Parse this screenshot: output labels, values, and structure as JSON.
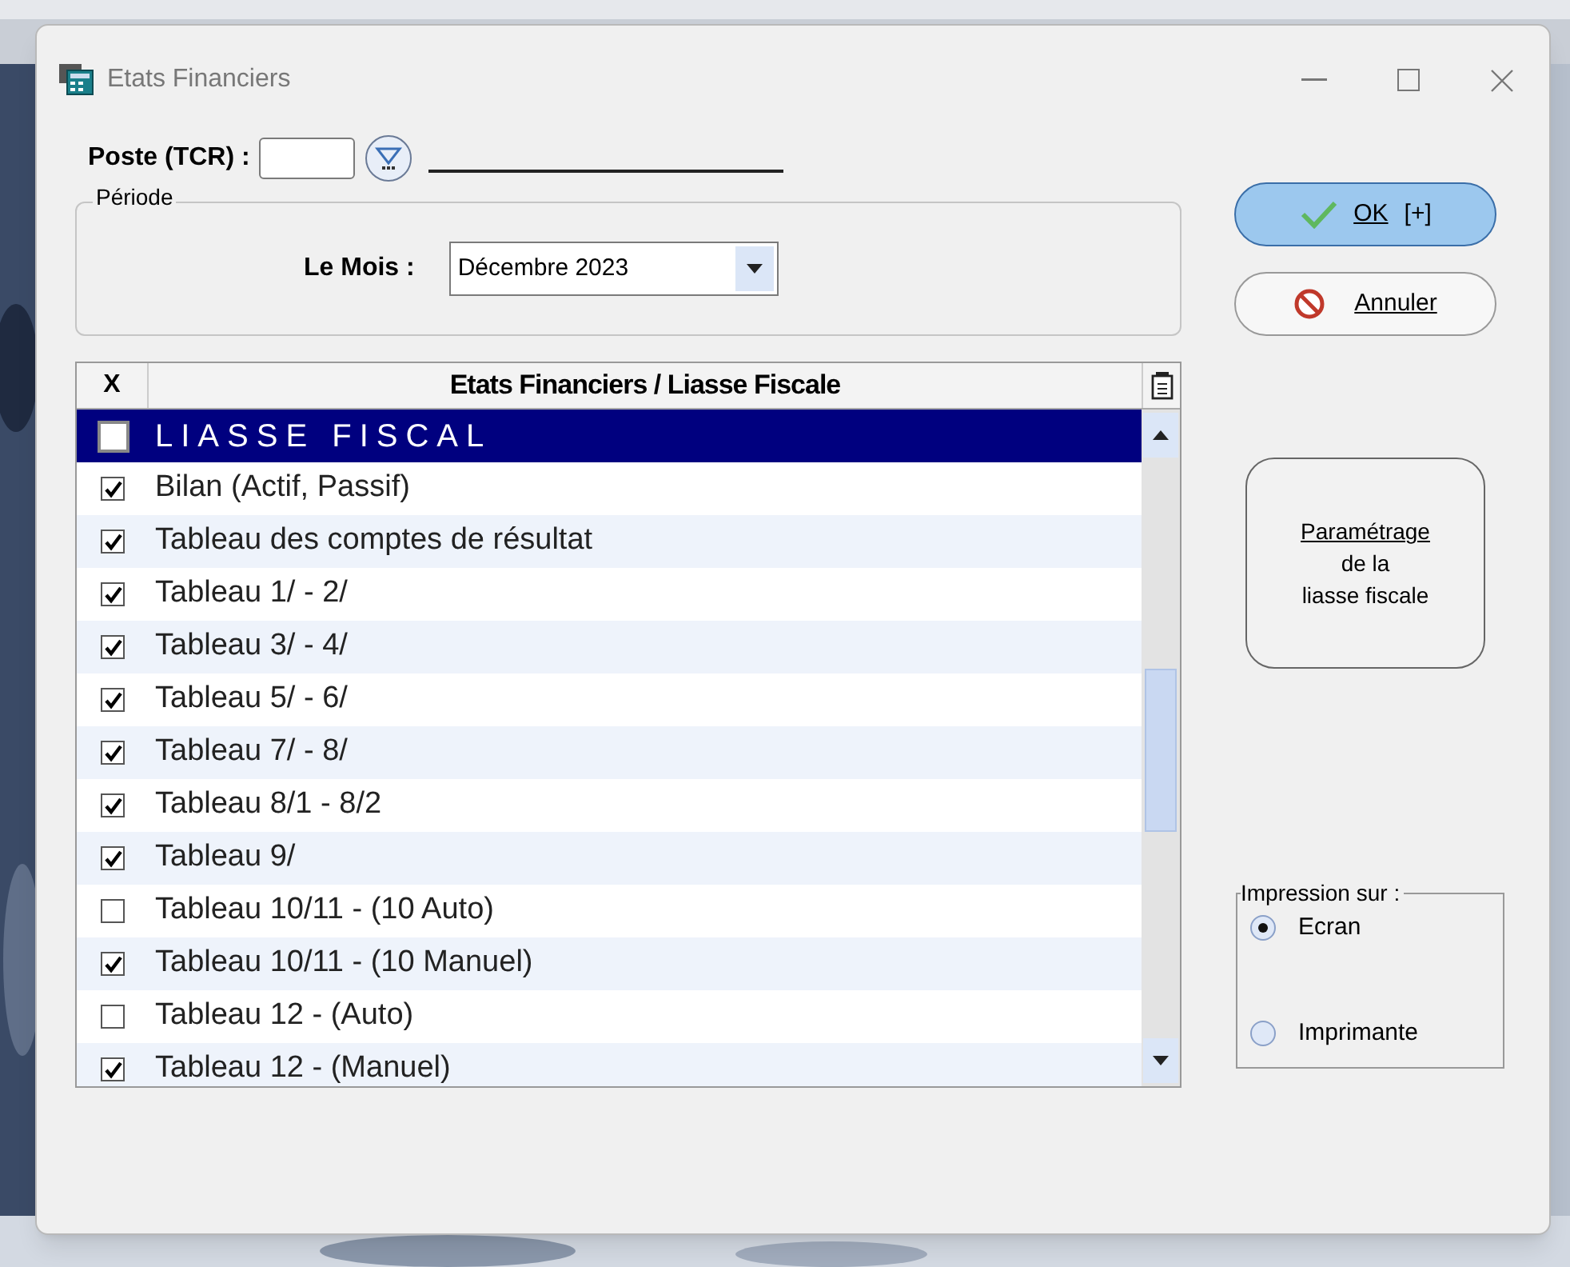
{
  "window": {
    "title": "Etats Financiers"
  },
  "poste": {
    "label": "Poste (TCR) :"
  },
  "periode": {
    "legend": "Période",
    "mois_label": "Le Mois :",
    "mois_value": "Décembre 2023"
  },
  "table": {
    "columns": [
      "X",
      "Etats Financiers / Liasse Fiscale"
    ],
    "rows": [
      {
        "kind": "group",
        "label": "LIASSE FISCAL",
        "checked": false,
        "selected": true
      },
      {
        "kind": "item",
        "label": "Bilan (Actif, Passif)",
        "checked": true,
        "selected": false
      },
      {
        "kind": "item",
        "label": "Tableau des comptes de résultat",
        "checked": true,
        "selected": false
      },
      {
        "kind": "item",
        "label": "Tableau 1/ - 2/",
        "checked": true,
        "selected": false
      },
      {
        "kind": "item",
        "label": "Tableau 3/ - 4/",
        "checked": true,
        "selected": false
      },
      {
        "kind": "item",
        "label": "Tableau 5/ - 6/",
        "checked": true,
        "selected": false
      },
      {
        "kind": "item",
        "label": "Tableau 7/ - 8/",
        "checked": true,
        "selected": false
      },
      {
        "kind": "item",
        "label": "Tableau 8/1 - 8/2",
        "checked": true,
        "selected": false
      },
      {
        "kind": "item",
        "label": "Tableau 9/",
        "checked": true,
        "selected": false
      },
      {
        "kind": "item",
        "label": "Tableau 10/11 - (10 Auto)",
        "checked": false,
        "selected": false
      },
      {
        "kind": "item",
        "label": "Tableau 10/11 - (10 Manuel)",
        "checked": true,
        "selected": false
      },
      {
        "kind": "item",
        "label": "Tableau 12 - (Auto)",
        "checked": false,
        "selected": false
      },
      {
        "kind": "item",
        "label": "Tableau 12 - (Manuel)",
        "checked": true,
        "selected": false
      }
    ]
  },
  "buttons": {
    "ok": "OK",
    "ok_suffix": "[+]",
    "cancel": "Annuler",
    "param": [
      "Paramétrage",
      "de la",
      "liasse fiscale"
    ]
  },
  "impression": {
    "legend": "Impression sur :",
    "options": [
      {
        "label": "Ecran",
        "selected": true
      },
      {
        "label": "Imprimante",
        "selected": false
      }
    ]
  }
}
